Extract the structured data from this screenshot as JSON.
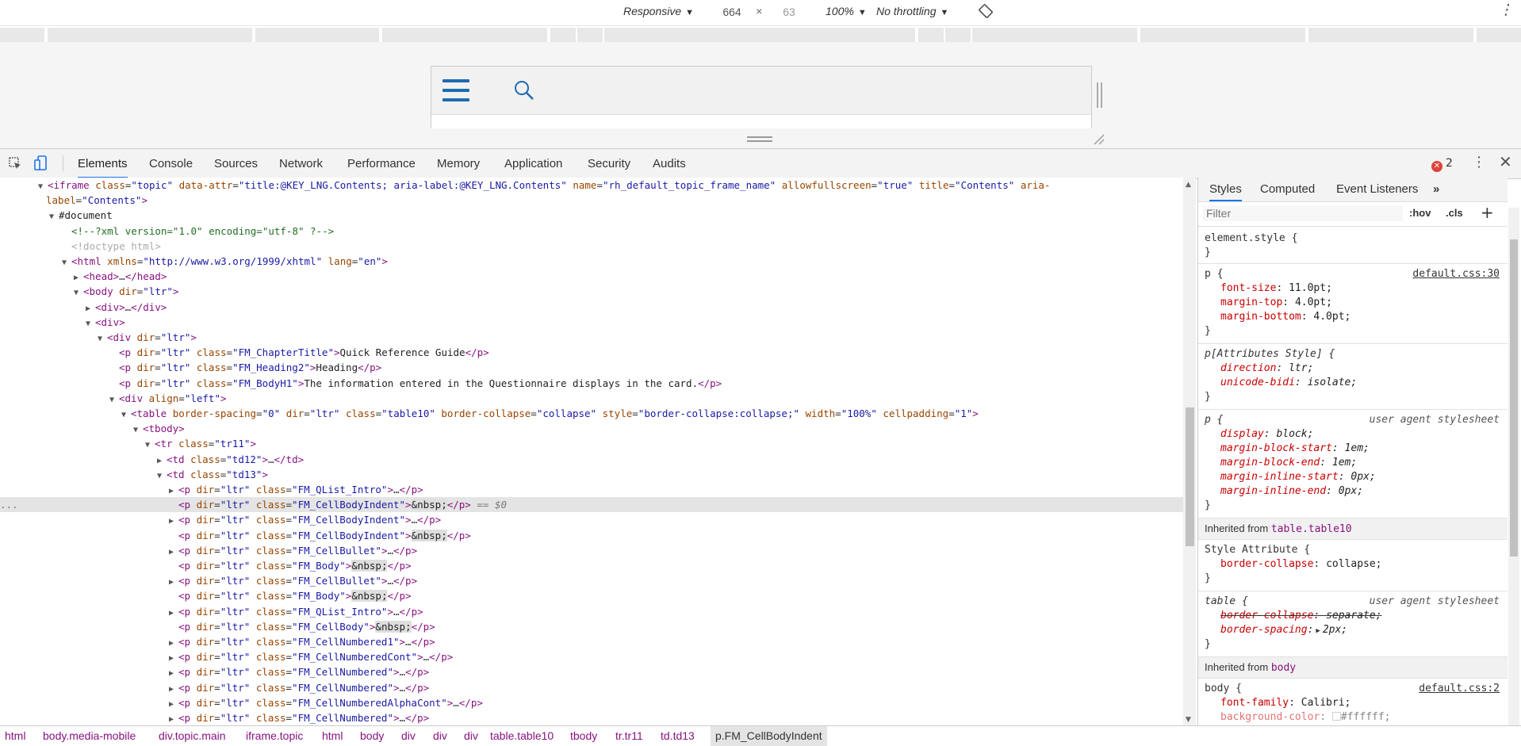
{
  "device_toolbar": {
    "mode": "Responsive",
    "width": "664",
    "times": "×",
    "height": "63",
    "zoom": "100%",
    "throttling": "No throttling"
  },
  "devtools_tabs": [
    "Elements",
    "Console",
    "Sources",
    "Network",
    "Performance",
    "Memory",
    "Application",
    "Security",
    "Audits"
  ],
  "error_count": "2",
  "dom_lines": [
    {
      "indent": 48,
      "tri": "▼",
      "html": "<span class='t'>&lt;iframe</span> <span class='a'>class</span>=<span class='v'>\"topic\"</span> <span class='a'>data-attr</span>=<span class='v'>\"title:@KEY_LNG.Contents; aria-label:@KEY_LNG.Contents\"</span> <span class='a'>name</span>=<span class='v'>\"rh_default_topic_frame_name\"</span> <span class='a'>allowfullscreen</span>=<span class='v'>\"true\"</span> <span class='a'>title</span>=<span class='v'>\"Contents\"</span> <span class='a'>aria-</span>"
    },
    {
      "indent": 46,
      "tri": "",
      "html": "<span class='a'>label</span>=<span class='v'>\"Contents\"</span><span class='t'>&gt;</span>"
    },
    {
      "indent": 62,
      "tri": "▼",
      "html": "<span class='tx'>#document</span>"
    },
    {
      "indent": 78,
      "tri": "",
      "html": "<span class='c'>&lt;!--?xml version=\"1.0\" encoding=\"utf-8\" ?--&gt;</span>"
    },
    {
      "indent": 78,
      "tri": "",
      "html": "<span class='dt'>&lt;!doctype html&gt;</span>"
    },
    {
      "indent": 78,
      "tri": "▼",
      "html": "<span class='t'>&lt;html</span> <span class='a'>xmlns</span>=<span class='v'>\"http://www.w3.org/1999/xhtml\"</span> <span class='a'>lang</span>=<span class='v'>\"en\"</span><span class='t'>&gt;</span>"
    },
    {
      "indent": 93,
      "tri": "▶",
      "html": "<span class='t'>&lt;head&gt;</span>…<span class='t'>&lt;/head&gt;</span>"
    },
    {
      "indent": 93,
      "tri": "▼",
      "html": "<span class='t'>&lt;body</span> <span class='a'>dir</span>=<span class='v'>\"ltr\"</span><span class='t'>&gt;</span>"
    },
    {
      "indent": 108,
      "tri": "▶",
      "html": "<span class='t'>&lt;div&gt;</span>…<span class='t'>&lt;/div&gt;</span>"
    },
    {
      "indent": 108,
      "tri": "▼",
      "html": "<span class='t'>&lt;div&gt;</span>"
    },
    {
      "indent": 123,
      "tri": "▼",
      "html": "<span class='t'>&lt;div</span> <span class='a'>dir</span>=<span class='v'>\"ltr\"</span><span class='t'>&gt;</span>"
    },
    {
      "indent": 138,
      "tri": "",
      "html": "<span class='t'>&lt;p</span> <span class='a'>dir</span>=<span class='v'>\"ltr\"</span> <span class='a'>class</span>=<span class='v'>\"FM_ChapterTitle\"</span><span class='t'>&gt;</span><span class='tx'>Quick Reference Guide</span><span class='t'>&lt;/p&gt;</span>"
    },
    {
      "indent": 138,
      "tri": "",
      "html": "<span class='t'>&lt;p</span> <span class='a'>dir</span>=<span class='v'>\"ltr\"</span> <span class='a'>class</span>=<span class='v'>\"FM_Heading2\"</span><span class='t'>&gt;</span><span class='tx'>Heading</span><span class='t'>&lt;/p&gt;</span>"
    },
    {
      "indent": 138,
      "tri": "",
      "html": "<span class='t'>&lt;p</span> <span class='a'>dir</span>=<span class='v'>\"ltr\"</span> <span class='a'>class</span>=<span class='v'>\"FM_BodyH1\"</span><span class='t'>&gt;</span><span class='tx'>The information entered in the Questionnaire displays in the card.</span><span class='t'>&lt;/p&gt;</span>"
    },
    {
      "indent": 138,
      "tri": "▼",
      "html": "<span class='t'>&lt;div</span> <span class='a'>align</span>=<span class='v'>\"left\"</span><span class='t'>&gt;</span>"
    },
    {
      "indent": 153,
      "tri": "▼",
      "html": "<span class='t'>&lt;table</span> <span class='a'>border-spacing</span>=<span class='v'>\"0\"</span> <span class='a'>dir</span>=<span class='v'>\"ltr\"</span> <span class='a'>class</span>=<span class='v'>\"table10\"</span> <span class='a'>border-collapse</span>=<span class='v'>\"collapse\"</span> <span class='a'>style</span>=<span class='v'>\"border-collapse:collapse;\"</span> <span class='a'>width</span>=<span class='v'>\"100%\"</span> <span class='a'>cellpadding</span>=<span class='v'>\"1\"</span><span class='t'>&gt;</span>"
    },
    {
      "indent": 168,
      "tri": "▼",
      "html": "<span class='t'>&lt;tbody&gt;</span>"
    },
    {
      "indent": 183,
      "tri": "▼",
      "html": "<span class='t'>&lt;tr</span> <span class='a'>class</span>=<span class='v'>\"tr11\"</span><span class='t'>&gt;</span>"
    },
    {
      "indent": 198,
      "tri": "▶",
      "html": "<span class='t'>&lt;td</span> <span class='a'>class</span>=<span class='v'>\"td12\"</span><span class='t'>&gt;</span>…<span class='t'>&lt;/td&gt;</span>"
    },
    {
      "indent": 198,
      "tri": "▼",
      "html": "<span class='t'>&lt;td</span> <span class='a'>class</span>=<span class='v'>\"td13\"</span><span class='t'>&gt;</span>"
    },
    {
      "indent": 213,
      "tri": "▶",
      "html": "<span class='t'>&lt;p</span> <span class='a'>dir</span>=<span class='v'>\"ltr\"</span> <span class='a'>class</span>=<span class='v'>\"FM_QList_Intro\"</span><span class='t'>&gt;</span>…<span class='t'>&lt;/p&gt;</span>"
    },
    {
      "indent": 213,
      "tri": "",
      "sel": true,
      "html": "<span class='t'>&lt;p</span> <span class='a'>dir</span>=<span class='v'>\"ltr\"</span> <span class='a'>class</span>=<span class='v'>\"FM_CellBodyIndent\"</span><span class='t'>&gt;</span><span class='nb'>&amp;nbsp;</span><span class='t'>&lt;/p&gt;</span> <span class='eq'>== $0</span>"
    },
    {
      "indent": 213,
      "tri": "▶",
      "html": "<span class='t'>&lt;p</span> <span class='a'>dir</span>=<span class='v'>\"ltr\"</span> <span class='a'>class</span>=<span class='v'>\"FM_CellBodyIndent\"</span><span class='t'>&gt;</span>…<span class='t'>&lt;/p&gt;</span>"
    },
    {
      "indent": 213,
      "tri": "",
      "html": "<span class='t'>&lt;p</span> <span class='a'>dir</span>=<span class='v'>\"ltr\"</span> <span class='a'>class</span>=<span class='v'>\"FM_CellBodyIndent\"</span><span class='t'>&gt;</span><span class='nb'>&amp;nbsp;</span><span class='t'>&lt;/p&gt;</span>"
    },
    {
      "indent": 213,
      "tri": "▶",
      "html": "<span class='t'>&lt;p</span> <span class='a'>dir</span>=<span class='v'>\"ltr\"</span> <span class='a'>class</span>=<span class='v'>\"FM_CellBullet\"</span><span class='t'>&gt;</span>…<span class='t'>&lt;/p&gt;</span>"
    },
    {
      "indent": 213,
      "tri": "",
      "html": "<span class='t'>&lt;p</span> <span class='a'>dir</span>=<span class='v'>\"ltr\"</span> <span class='a'>class</span>=<span class='v'>\"FM_Body\"</span><span class='t'>&gt;</span><span class='nb'>&amp;nbsp;</span><span class='t'>&lt;/p&gt;</span>"
    },
    {
      "indent": 213,
      "tri": "▶",
      "html": "<span class='t'>&lt;p</span> <span class='a'>dir</span>=<span class='v'>\"ltr\"</span> <span class='a'>class</span>=<span class='v'>\"FM_CellBullet\"</span><span class='t'>&gt;</span>…<span class='t'>&lt;/p&gt;</span>"
    },
    {
      "indent": 213,
      "tri": "",
      "html": "<span class='t'>&lt;p</span> <span class='a'>dir</span>=<span class='v'>\"ltr\"</span> <span class='a'>class</span>=<span class='v'>\"FM_Body\"</span><span class='t'>&gt;</span><span class='nb'>&amp;nbsp;</span><span class='t'>&lt;/p&gt;</span>"
    },
    {
      "indent": 213,
      "tri": "▶",
      "html": "<span class='t'>&lt;p</span> <span class='a'>dir</span>=<span class='v'>\"ltr\"</span> <span class='a'>class</span>=<span class='v'>\"FM_QList_Intro\"</span><span class='t'>&gt;</span>…<span class='t'>&lt;/p&gt;</span>"
    },
    {
      "indent": 213,
      "tri": "",
      "html": "<span class='t'>&lt;p</span> <span class='a'>dir</span>=<span class='v'>\"ltr\"</span> <span class='a'>class</span>=<span class='v'>\"FM_CellBody\"</span><span class='t'>&gt;</span><span class='nb'>&amp;nbsp;</span><span class='t'>&lt;/p&gt;</span>"
    },
    {
      "indent": 213,
      "tri": "▶",
      "html": "<span class='t'>&lt;p</span> <span class='a'>dir</span>=<span class='v'>\"ltr\"</span> <span class='a'>class</span>=<span class='v'>\"FM_CellNumbered1\"</span><span class='t'>&gt;</span>…<span class='t'>&lt;/p&gt;</span>"
    },
    {
      "indent": 213,
      "tri": "▶",
      "html": "<span class='t'>&lt;p</span> <span class='a'>dir</span>=<span class='v'>\"ltr\"</span> <span class='a'>class</span>=<span class='v'>\"FM_CellNumberedCont\"</span><span class='t'>&gt;</span>…<span class='t'>&lt;/p&gt;</span>"
    },
    {
      "indent": 213,
      "tri": "▶",
      "html": "<span class='t'>&lt;p</span> <span class='a'>dir</span>=<span class='v'>\"ltr\"</span> <span class='a'>class</span>=<span class='v'>\"FM_CellNumbered\"</span><span class='t'>&gt;</span>…<span class='t'>&lt;/p&gt;</span>"
    },
    {
      "indent": 213,
      "tri": "▶",
      "html": "<span class='t'>&lt;p</span> <span class='a'>dir</span>=<span class='v'>\"ltr\"</span> <span class='a'>class</span>=<span class='v'>\"FM_CellNumbered\"</span><span class='t'>&gt;</span>…<span class='t'>&lt;/p&gt;</span>"
    },
    {
      "indent": 213,
      "tri": "▶",
      "html": "<span class='t'>&lt;p</span> <span class='a'>dir</span>=<span class='v'>\"ltr\"</span> <span class='a'>class</span>=<span class='v'>\"FM_CellNumberedAlphaCont\"</span><span class='t'>&gt;</span>…<span class='t'>&lt;/p&gt;</span>"
    },
    {
      "indent": 213,
      "tri": "▶",
      "html": "<span class='t'>&lt;p</span> <span class='a'>dir</span>=<span class='v'>\"ltr\"</span> <span class='a'>class</span>=<span class='v'>\"FM_CellNumbered\"</span><span class='t'>&gt;</span>…<span class='t'>&lt;/p&gt;</span>"
    }
  ],
  "styles_pane": {
    "tabs": [
      "Styles",
      "Computed",
      "Event Listeners",
      "»"
    ],
    "filter_placeholder": "Filter",
    "hov": ":hov",
    "cls": ".cls",
    "add": "+",
    "element_style": "element.style {",
    "close_brace": "}",
    "p_rule": {
      "selector": "p {",
      "source": "default.css:30",
      "props": [
        [
          "font-size",
          "11.0pt;"
        ],
        [
          "margin-top",
          "4.0pt;"
        ],
        [
          "margin-bottom",
          "4.0pt;"
        ]
      ]
    },
    "attr_rule": {
      "selector": "p[Attributes Style] {",
      "props": [
        [
          "direction",
          "ltr;"
        ],
        [
          "unicode-bidi",
          "isolate;"
        ]
      ]
    },
    "ua_rule": {
      "selector": "p {",
      "source": "user agent stylesheet",
      "props": [
        [
          "display",
          "block;"
        ],
        [
          "margin-block-start",
          "1em;"
        ],
        [
          "margin-block-end",
          "1em;"
        ],
        [
          "margin-inline-start",
          "0px;"
        ],
        [
          "margin-inline-end",
          "0px;"
        ]
      ]
    },
    "inherited_table": {
      "label": "Inherited from ",
      "target": "table.table10"
    },
    "style_attr": {
      "selector": "Style Attribute {",
      "props": [
        [
          "border-collapse",
          "collapse;"
        ]
      ]
    },
    "table_rule": {
      "selector": "table {",
      "source": "user agent stylesheet",
      "props": [
        [
          "border-collapse",
          "separate;"
        ],
        [
          "border-spacing",
          "2px;"
        ]
      ]
    },
    "inherited_body": {
      "label": "Inherited from ",
      "target": "body"
    },
    "body_rule": {
      "selector": "body {",
      "source": "default.css:2",
      "props": [
        [
          "font-family",
          "Calibri;"
        ],
        [
          "background-color",
          "#ffffff;"
        ]
      ]
    }
  },
  "breadcrumbs": [
    "html",
    "body.media-mobile",
    "div.topic.main",
    "iframe.topic",
    "html",
    "body",
    "div",
    "div",
    "div",
    "table.table10",
    "tbody",
    "tr.tr11",
    "td.td13",
    "p.FM_CellBodyIndent"
  ],
  "colors": {
    "accent": "#1a73e8",
    "hamburger": "#1c6bb0",
    "error": "#e0413a"
  }
}
